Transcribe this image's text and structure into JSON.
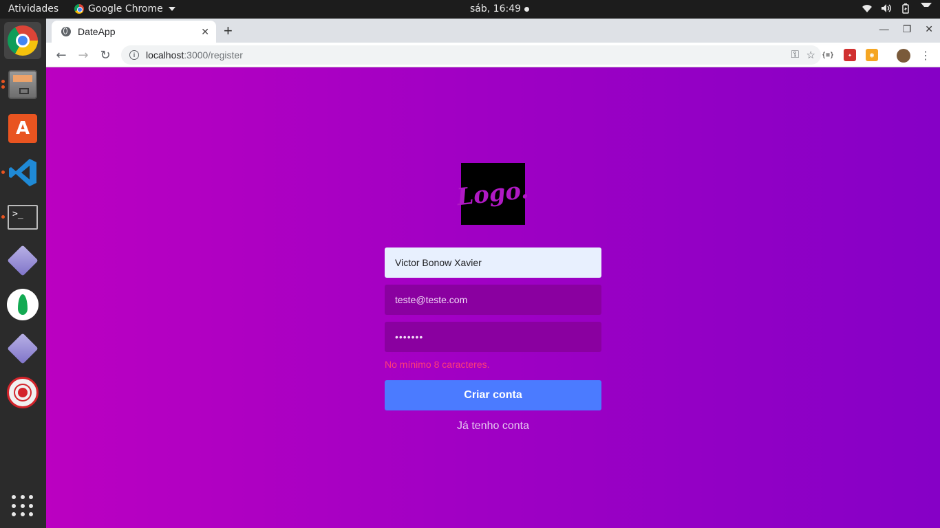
{
  "topbar": {
    "activities": "Atividades",
    "app_name": "Google Chrome",
    "clock": "sáb, 16:49"
  },
  "dock": {
    "items": [
      "chrome-icon",
      "files-icon",
      "software-store-icon",
      "vscode-icon",
      "terminal-icon",
      "diamond-app-icon",
      "mongodb-compass-icon",
      "diamond-app-icon",
      "atom-icon",
      "show-apps-icon"
    ]
  },
  "browser": {
    "tab_title": "DateApp",
    "url_host": "localhost",
    "url_path": ":3000/register"
  },
  "form": {
    "logo_text": "Logo.",
    "name_value": "Victor Bonow Xavier",
    "email_value": "teste@teste.com",
    "password_value": "•••••••",
    "error_text": "No mínimo 8 caracteres.",
    "submit_label": "Criar conta",
    "login_link": "Já tenho conta"
  },
  "colors": {
    "gradient_start": "#bb00c1",
    "gradient_end": "#8600c6",
    "button": "#4b7bff",
    "error": "#ff3c78"
  }
}
